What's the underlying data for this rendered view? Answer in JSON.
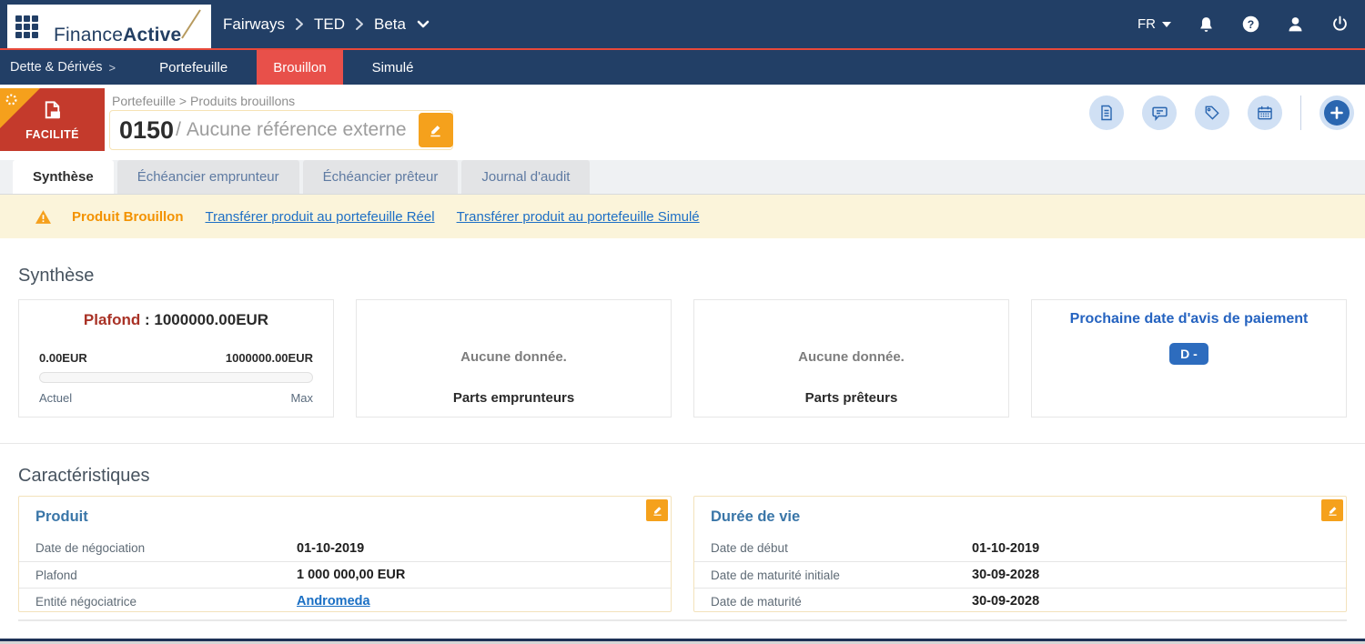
{
  "colors": {
    "navy": "#223f66",
    "active_tab_red": "#e8504a",
    "facility_red": "#c43a2c",
    "orange_accent": "#f5a11c",
    "warning_bg": "#fbf4da",
    "warning_orange": "#f39200",
    "link_blue": "#1e6fc5",
    "steel_blue": "#3a76a8",
    "plafond_red": "#a93226",
    "badge_blue": "#2d6cbe",
    "icon_circle_bg": "#d0e0f4",
    "icon_blue": "#2a66b0",
    "gold_slash": "#b79a5e"
  },
  "topbar": {
    "logo_finance": "Finance",
    "logo_active": "Active",
    "breadcrumb": {
      "items": [
        "Fairways",
        "TED",
        "Beta"
      ]
    },
    "language": "FR"
  },
  "nav": {
    "section": "Dette & Dérivés",
    "section_chevron": ">",
    "items": [
      {
        "label": "Portefeuille"
      },
      {
        "label": "Brouillon"
      },
      {
        "label": "Simulé"
      }
    ]
  },
  "product_header": {
    "badge": "FACILITÉ",
    "breadcrumb": "Portefeuille > Produits brouillons",
    "number": "0150",
    "slash": "/",
    "reference": "Aucune référence externe"
  },
  "tabs": {
    "items": [
      {
        "label": "Synthèse"
      },
      {
        "label": "Échéancier emprunteur"
      },
      {
        "label": "Échéancier prêteur"
      },
      {
        "label": "Journal d'audit"
      }
    ]
  },
  "warning": {
    "title": "Produit Brouillon",
    "link_reel": "Transférer produit au portefeuille Réel",
    "link_simule": "Transférer produit au portefeuille Simulé"
  },
  "synthese": {
    "title": "Synthèse",
    "plafond_card": {
      "label": "Plafond",
      "colon": ":",
      "value": "1000000.00EUR",
      "min": "0.00EUR",
      "max": "1000000.00EUR",
      "caption_left": "Actuel",
      "caption_right": "Max",
      "progress_percent": 0
    },
    "emprunteurs_card": {
      "empty": "Aucune donnée.",
      "title": "Parts emprunteurs"
    },
    "preteurs_card": {
      "empty": "Aucune donnée.",
      "title": "Parts prêteurs"
    },
    "paiement_card": {
      "title": "Prochaine date d'avis de paiement",
      "badge": "D -"
    }
  },
  "caracteristiques": {
    "title": "Caractéristiques",
    "produit": {
      "title": "Produit",
      "rows": [
        {
          "label": "Date de négociation",
          "value": "01-10-2019"
        },
        {
          "label": "Plafond",
          "value": "1 000 000,00 EUR"
        },
        {
          "label": "Entité négociatrice",
          "value": "Andromeda"
        }
      ]
    },
    "duree": {
      "title": "Durée de vie",
      "rows": [
        {
          "label": "Date de début",
          "value": "01-10-2019"
        },
        {
          "label": "Date de maturité initiale",
          "value": "30-09-2028"
        },
        {
          "label": "Date de maturité",
          "value": "30-09-2028"
        }
      ]
    }
  }
}
